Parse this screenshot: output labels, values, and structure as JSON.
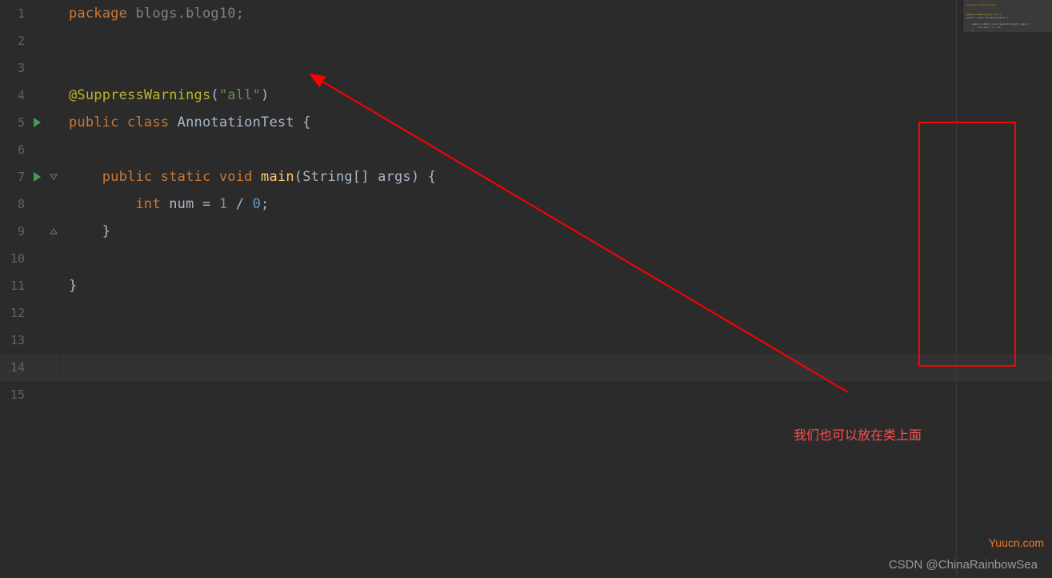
{
  "gutter": {
    "lines": [
      {
        "n": "1",
        "run": false,
        "fold": null,
        "active": false
      },
      {
        "n": "2",
        "run": false,
        "fold": null,
        "active": false
      },
      {
        "n": "3",
        "run": false,
        "fold": null,
        "active": false
      },
      {
        "n": "4",
        "run": false,
        "fold": null,
        "active": false
      },
      {
        "n": "5",
        "run": true,
        "fold": null,
        "active": false
      },
      {
        "n": "6",
        "run": false,
        "fold": null,
        "active": false
      },
      {
        "n": "7",
        "run": true,
        "fold": "open",
        "active": false
      },
      {
        "n": "8",
        "run": false,
        "fold": null,
        "active": false
      },
      {
        "n": "9",
        "run": false,
        "fold": "close",
        "active": false
      },
      {
        "n": "10",
        "run": false,
        "fold": null,
        "active": false
      },
      {
        "n": "11",
        "run": false,
        "fold": null,
        "active": false
      },
      {
        "n": "12",
        "run": false,
        "fold": null,
        "active": false
      },
      {
        "n": "13",
        "run": false,
        "fold": null,
        "active": false
      },
      {
        "n": "14",
        "run": false,
        "fold": null,
        "active": true
      },
      {
        "n": "15",
        "run": false,
        "fold": null,
        "active": false
      }
    ]
  },
  "code": {
    "l1": {
      "kw": "package",
      "rest": " blogs.blog10;"
    },
    "l4": {
      "ann": "@SuppressWarnings",
      "p1": "(",
      "str": "\"all\"",
      "p2": ")"
    },
    "l5": {
      "kw": "public class ",
      "cls": "AnnotationTest ",
      "brace": "{"
    },
    "l7": {
      "indent": "    ",
      "kw": "public static void ",
      "fn": "main",
      "sig": "(String[] args) ",
      "brace": "{"
    },
    "l8": {
      "indent": "        ",
      "kw": "int ",
      "var": "num = ",
      "n1": "1",
      "op": " / ",
      "n2": "0",
      "semi": ";"
    },
    "l9": {
      "indent": "    ",
      "brace": "}"
    },
    "l11": {
      "brace": "}"
    }
  },
  "annotation": {
    "text": "我们也可以放在类上面"
  },
  "watermarks": {
    "csdn": "CSDN @ChinaRainbowSea",
    "yuucn": "Yuucn.com"
  },
  "minimap": {
    "lines": [
      "package blogs.blog10;",
      "",
      "",
      "@SuppressWarnings(\"all\")",
      "public class AnnotationTest {",
      "",
      "    public static void main(String[] args) {",
      "        int num = 1 / 0;",
      "    }",
      "",
      "}"
    ]
  }
}
